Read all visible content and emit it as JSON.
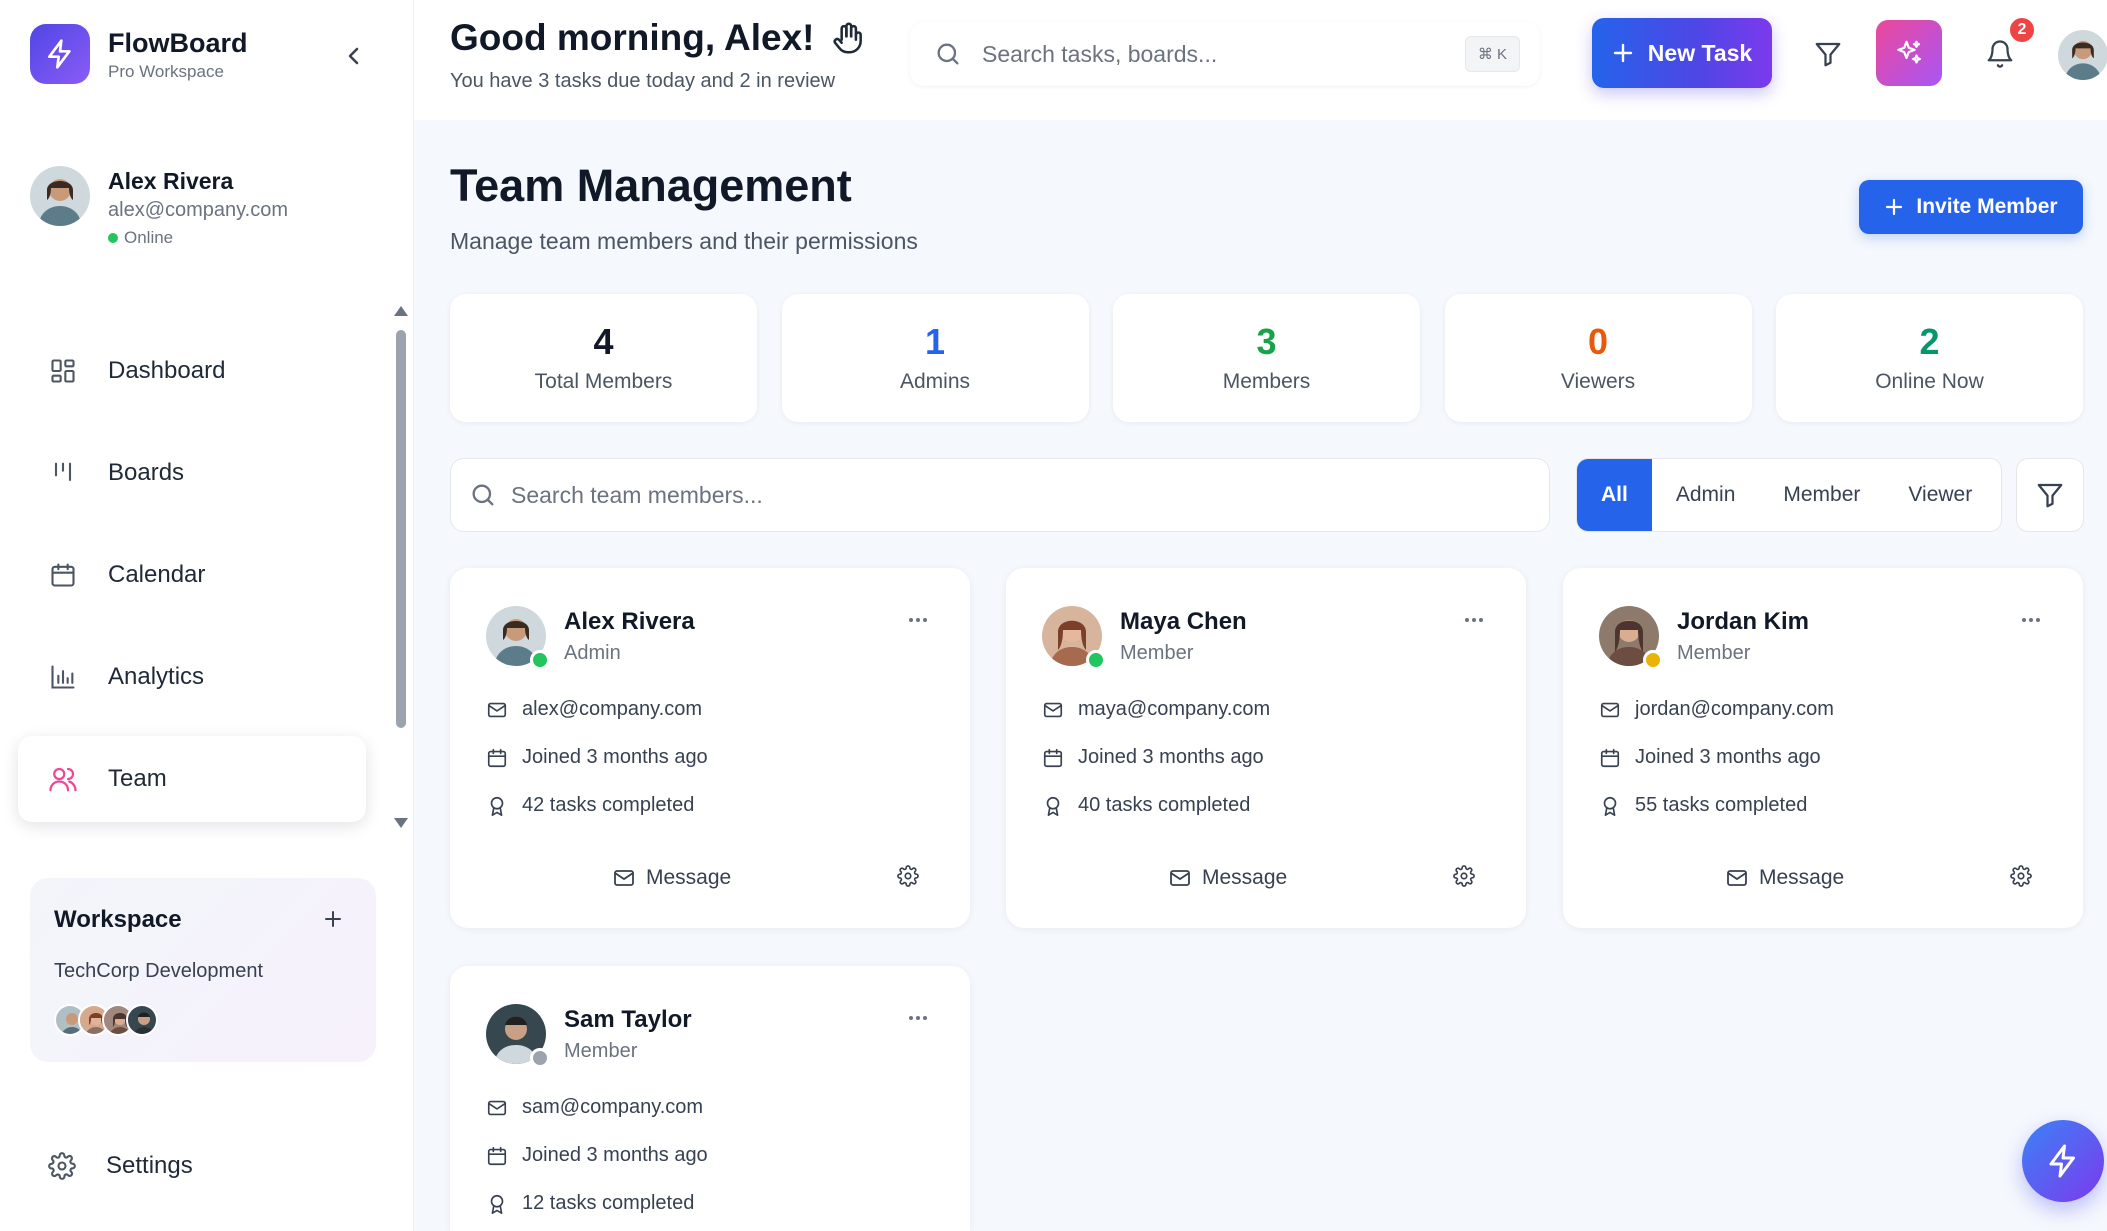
{
  "sidebar": {
    "brand": {
      "name": "FlowBoard",
      "subtitle": "Pro Workspace"
    },
    "user": {
      "name": "Alex Rivera",
      "email": "alex@company.com",
      "status": "Online"
    },
    "nav": [
      {
        "label": "Dashboard",
        "icon": "grid-icon",
        "active": false
      },
      {
        "label": "Boards",
        "icon": "columns-icon",
        "active": false
      },
      {
        "label": "Calendar",
        "icon": "calendar-icon",
        "active": false
      },
      {
        "label": "Analytics",
        "icon": "bar-chart-icon",
        "active": false
      },
      {
        "label": "Team",
        "icon": "users-icon",
        "active": true
      }
    ],
    "workspace": {
      "title": "Workspace",
      "name": "TechCorp Development"
    },
    "settings_label": "Settings"
  },
  "header": {
    "greeting": "Good morning, Alex!",
    "subtitle": "You have 3 tasks due today and 2 in review",
    "search_placeholder": "Search tasks, boards...",
    "shortcut": "⌘ K",
    "new_task_label": "New Task",
    "notification_count": "2"
  },
  "main": {
    "title": "Team Management",
    "subtitle": "Manage team members and their permissions",
    "invite_label": "Invite Member",
    "stats": [
      {
        "value": "4",
        "label": "Total Members",
        "color": "#111827"
      },
      {
        "value": "1",
        "label": "Admins",
        "color": "#2563eb"
      },
      {
        "value": "3",
        "label": "Members",
        "color": "#16a34a"
      },
      {
        "value": "0",
        "label": "Viewers",
        "color": "#ea580c"
      },
      {
        "value": "2",
        "label": "Online Now",
        "color": "#059669"
      }
    ],
    "member_search_placeholder": "Search team members...",
    "role_filters": [
      "All",
      "Admin",
      "Member",
      "Viewer"
    ],
    "active_role_filter": "All",
    "members": [
      {
        "name": "Alex Rivera",
        "role": "Admin",
        "email": "alex@company.com",
        "joined": "Joined 3 months ago",
        "tasks": "42 tasks completed",
        "status_color": "#22c55e",
        "message_label": "Message"
      },
      {
        "name": "Maya Chen",
        "role": "Member",
        "email": "maya@company.com",
        "joined": "Joined 3 months ago",
        "tasks": "40 tasks completed",
        "status_color": "#22c55e",
        "message_label": "Message"
      },
      {
        "name": "Jordan Kim",
        "role": "Member",
        "email": "jordan@company.com",
        "joined": "Joined 3 months ago",
        "tasks": "55 tasks completed",
        "status_color": "#eab308",
        "message_label": "Message"
      },
      {
        "name": "Sam Taylor",
        "role": "Member",
        "email": "sam@company.com",
        "joined": "Joined 3 months ago",
        "tasks": "12 tasks completed",
        "status_color": "#9ca3af",
        "message_label": "Message"
      }
    ]
  },
  "colors": {
    "accent": "#2563eb",
    "brand_gradient_start": "#4f46e5",
    "brand_gradient_end": "#8b5cf6",
    "ai_gradient_start": "#ec4899",
    "ai_gradient_end": "#a855f7"
  }
}
